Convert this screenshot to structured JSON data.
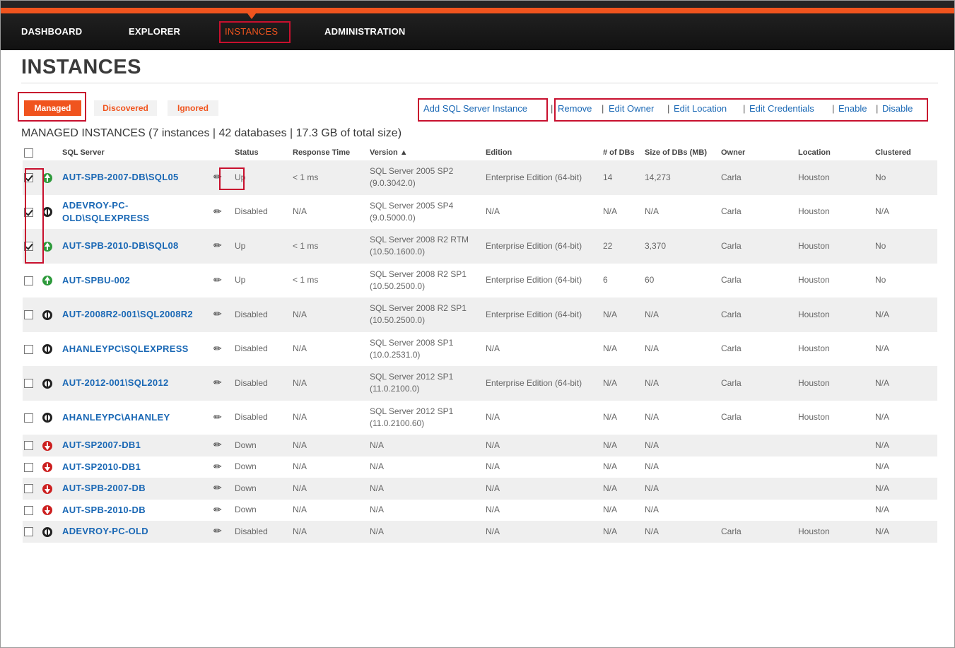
{
  "nav": {
    "items": [
      {
        "label": "DASHBOARD",
        "active": false
      },
      {
        "label": "EXPLORER",
        "active": false
      },
      {
        "label": "INSTANCES",
        "active": true
      },
      {
        "label": "ADMINISTRATION",
        "active": false
      }
    ],
    "accent_color": "#f0541e"
  },
  "page_title": "INSTANCES",
  "filters": {
    "managed": "Managed",
    "discovered": "Discovered",
    "ignored": "Ignored"
  },
  "actions": {
    "add": "Add SQL Server Instance",
    "remove": "Remove",
    "edit_owner": "Edit Owner",
    "edit_location": "Edit Location",
    "edit_credentials": "Edit Credentials",
    "enable": "Enable",
    "disable": "Disable",
    "separator": "|"
  },
  "summary": "MANAGED INSTANCES (7 instances | 42 databases | 17.3 GB of total size)",
  "columns": {
    "sql_server": "SQL Server",
    "status": "Status",
    "response_time": "Response Time",
    "version": "Version ▲",
    "edition": "Edition",
    "num_dbs": "# of DBs",
    "size_dbs": "Size of DBs (MB)",
    "owner": "Owner",
    "location": "Location",
    "clustered": "Clustered"
  },
  "rows": [
    {
      "checked": true,
      "state": "up",
      "server": "AUT-SPB-2007-DB\\SQL05",
      "status": "Up",
      "response": "< 1 ms",
      "version": "SQL Server 2005 SP2 (9.0.3042.0)",
      "edition": "Enterprise Edition (64-bit)",
      "dbs": "14",
      "size": "14,273",
      "owner": "Carla",
      "location": "Houston",
      "clustered": "No"
    },
    {
      "checked": true,
      "state": "disabled",
      "server": "ADEVROY-PC-OLD\\SQLEXPRESS",
      "status": "Disabled",
      "response": "N/A",
      "version": "SQL Server 2005 SP4 (9.0.5000.0)",
      "edition": "N/A",
      "dbs": "N/A",
      "size": "N/A",
      "owner": "Carla",
      "location": "Houston",
      "clustered": "N/A"
    },
    {
      "checked": true,
      "state": "up",
      "server": "AUT-SPB-2010-DB\\SQL08",
      "status": "Up",
      "response": "< 1 ms",
      "version": "SQL Server 2008 R2 RTM (10.50.1600.0)",
      "edition": "Enterprise Edition (64-bit)",
      "dbs": "22",
      "size": "3,370",
      "owner": "Carla",
      "location": "Houston",
      "clustered": "No"
    },
    {
      "checked": false,
      "state": "up",
      "server": "AUT-SPBU-002",
      "status": "Up",
      "response": "< 1 ms",
      "version": "SQL Server 2008 R2 SP1 (10.50.2500.0)",
      "edition": "Enterprise Edition (64-bit)",
      "dbs": "6",
      "size": "60",
      "owner": "Carla",
      "location": "Houston",
      "clustered": "No"
    },
    {
      "checked": false,
      "state": "disabled",
      "server": "AUT-2008R2-001\\SQL2008R2",
      "status": "Disabled",
      "response": "N/A",
      "version": "SQL Server 2008 R2 SP1 (10.50.2500.0)",
      "edition": "Enterprise Edition (64-bit)",
      "dbs": "N/A",
      "size": "N/A",
      "owner": "Carla",
      "location": "Houston",
      "clustered": "N/A"
    },
    {
      "checked": false,
      "state": "disabled",
      "server": "AHANLEYPC\\SQLEXPRESS",
      "status": "Disabled",
      "response": "N/A",
      "version": "SQL Server 2008 SP1 (10.0.2531.0)",
      "edition": "N/A",
      "dbs": "N/A",
      "size": "N/A",
      "owner": "Carla",
      "location": "Houston",
      "clustered": "N/A"
    },
    {
      "checked": false,
      "state": "disabled",
      "server": "AUT-2012-001\\SQL2012",
      "status": "Disabled",
      "response": "N/A",
      "version": "SQL Server 2012 SP1 (11.0.2100.0)",
      "edition": "Enterprise Edition (64-bit)",
      "dbs": "N/A",
      "size": "N/A",
      "owner": "Carla",
      "location": "Houston",
      "clustered": "N/A"
    },
    {
      "checked": false,
      "state": "disabled",
      "server": "AHANLEYPC\\AHANLEY",
      "status": "Disabled",
      "response": "N/A",
      "version": "SQL Server 2012 SP1 (11.0.2100.60)",
      "edition": "N/A",
      "dbs": "N/A",
      "size": "N/A",
      "owner": "Carla",
      "location": "Houston",
      "clustered": "N/A"
    },
    {
      "checked": false,
      "state": "down",
      "server": "AUT-SP2007-DB1",
      "status": "Down",
      "response": "N/A",
      "version": "N/A",
      "edition": "N/A",
      "dbs": "N/A",
      "size": "N/A",
      "owner": "",
      "location": "",
      "clustered": "N/A"
    },
    {
      "checked": false,
      "state": "down",
      "server": "AUT-SP2010-DB1",
      "status": "Down",
      "response": "N/A",
      "version": "N/A",
      "edition": "N/A",
      "dbs": "N/A",
      "size": "N/A",
      "owner": "",
      "location": "",
      "clustered": "N/A"
    },
    {
      "checked": false,
      "state": "down",
      "server": "AUT-SPB-2007-DB",
      "status": "Down",
      "response": "N/A",
      "version": "N/A",
      "edition": "N/A",
      "dbs": "N/A",
      "size": "N/A",
      "owner": "",
      "location": "",
      "clustered": "N/A"
    },
    {
      "checked": false,
      "state": "down",
      "server": "AUT-SPB-2010-DB",
      "status": "Down",
      "response": "N/A",
      "version": "N/A",
      "edition": "N/A",
      "dbs": "N/A",
      "size": "N/A",
      "owner": "",
      "location": "",
      "clustered": "N/A"
    },
    {
      "checked": false,
      "state": "disabled",
      "server": "ADEVROY-PC-OLD",
      "status": "Disabled",
      "response": "N/A",
      "version": "N/A",
      "edition": "N/A",
      "dbs": "N/A",
      "size": "N/A",
      "owner": "Carla",
      "location": "Houston",
      "clustered": "N/A"
    }
  ]
}
